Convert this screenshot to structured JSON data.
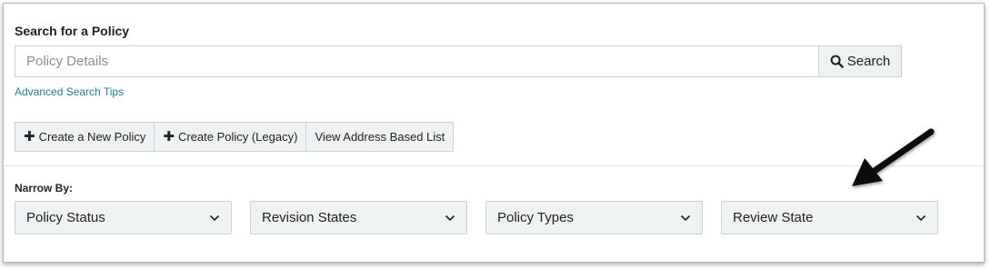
{
  "search": {
    "heading": "Search for a Policy",
    "placeholder": "Policy Details",
    "button_label": "Search",
    "tips_link": "Advanced Search Tips"
  },
  "actions": {
    "create_new": "Create a New Policy",
    "create_legacy": "Create Policy (Legacy)",
    "address_list": "View Address Based List"
  },
  "filters": {
    "label": "Narrow By:",
    "items": [
      {
        "label": "Policy Status"
      },
      {
        "label": "Revision States"
      },
      {
        "label": "Policy Types"
      },
      {
        "label": "Review State"
      }
    ]
  },
  "colors": {
    "link": "#2a7b8e",
    "button_bg": "#eef2f2",
    "border": "#c8d3d3"
  },
  "icons": [
    "search-icon",
    "plus-icon",
    "chevron-down-icon",
    "annotation-arrow"
  ]
}
